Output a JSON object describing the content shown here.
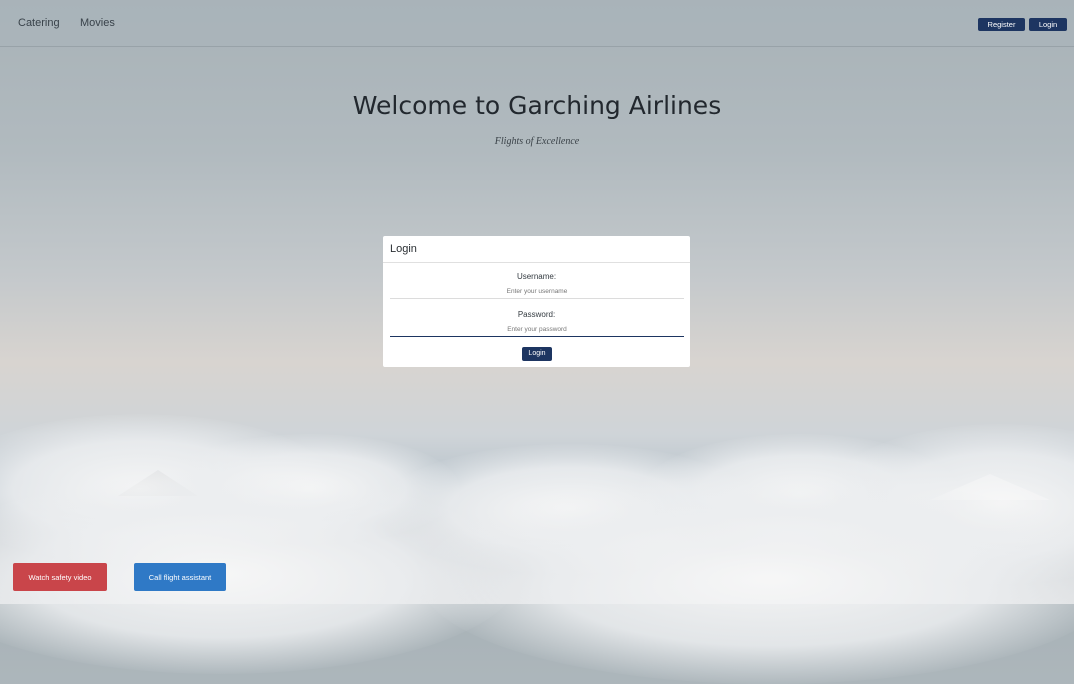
{
  "nav": {
    "links": [
      "Catering",
      "Movies"
    ],
    "register_label": "Register",
    "login_label": "Login",
    "button_color": "#1d3561"
  },
  "hero": {
    "title": "Welcome to Garching Airlines",
    "subtitle": "Flights of Excellence"
  },
  "login_card": {
    "header": "Login",
    "username_label": "Username:",
    "username_placeholder": "Enter your username",
    "password_label": "Password:",
    "password_placeholder": "Enter your password",
    "submit_label": "Login"
  },
  "actions": {
    "safety_video_label": "Watch safety video",
    "safety_video_color": "#c9454a",
    "flight_assistant_label": "Call flight assistant",
    "flight_assistant_color": "#2f79c6"
  }
}
